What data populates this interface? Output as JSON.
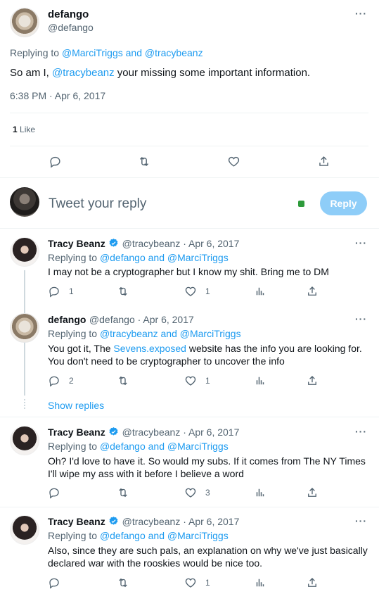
{
  "main_tweet": {
    "name": "defango",
    "handle": "@defango",
    "replying_label": "Replying to",
    "replying_to": "@MarciTriggs and @tracybeanz",
    "text_before": "So am I, ",
    "mention": "@tracybeanz",
    "text_after": " your missing some important information.",
    "time": "6:38 PM · Apr 6, 2017",
    "likes_count": "1",
    "likes_label": "Like"
  },
  "composer": {
    "placeholder": "Tweet your reply",
    "button": "Reply"
  },
  "replies": [
    {
      "name": "Tracy Beanz",
      "meta": "@tracybeanz · Apr 6, 2017",
      "replying_label": "Replying to",
      "replying_to": "@defango and @MarciTriggs",
      "line1": "I may not be a cryptographer but I know my shit. Bring me to DM",
      "reply_count": "1",
      "retweet_count": "",
      "like_count": "1"
    },
    {
      "name": "defango",
      "meta": "@defango · Apr 6, 2017",
      "replying_label": "Replying to",
      "replying_to": "@tracybeanz and @MarciTriggs",
      "line1_before": "You got it, The ",
      "line1_link": "Sevens.exposed",
      "line1_after": " website has the info you are looking for.",
      "line2": "You don't need to be cryptographer to uncover the info",
      "reply_count": "2",
      "retweet_count": "",
      "like_count": "1"
    },
    {
      "name": "Tracy Beanz",
      "meta": "@tracybeanz · Apr 6, 2017",
      "replying_label": "Replying to",
      "replying_to": "@defango and @MarciTriggs",
      "line1": "Oh? I'd love to have it. So would my subs. If it comes from The NY Times",
      "line2": "I'll wipe my ass with it before I believe a word",
      "reply_count": "",
      "retweet_count": "",
      "like_count": "3"
    },
    {
      "name": "Tracy Beanz",
      "meta": "@tracybeanz · Apr 6, 2017",
      "replying_label": "Replying to",
      "replying_to": "@defango and @MarciTriggs",
      "line1": "Also, since they are such pals, an explanation on why we've just basically",
      "line2": "declared war with the rooskies would be nice too.",
      "reply_count": "",
      "retweet_count": "",
      "like_count": "1"
    }
  ],
  "show_replies": "Show replies",
  "colors": {
    "accent": "#1d9bf0",
    "muted": "#536471",
    "reply_button": "#8ecdf8",
    "presence": "#2e9b3b"
  }
}
